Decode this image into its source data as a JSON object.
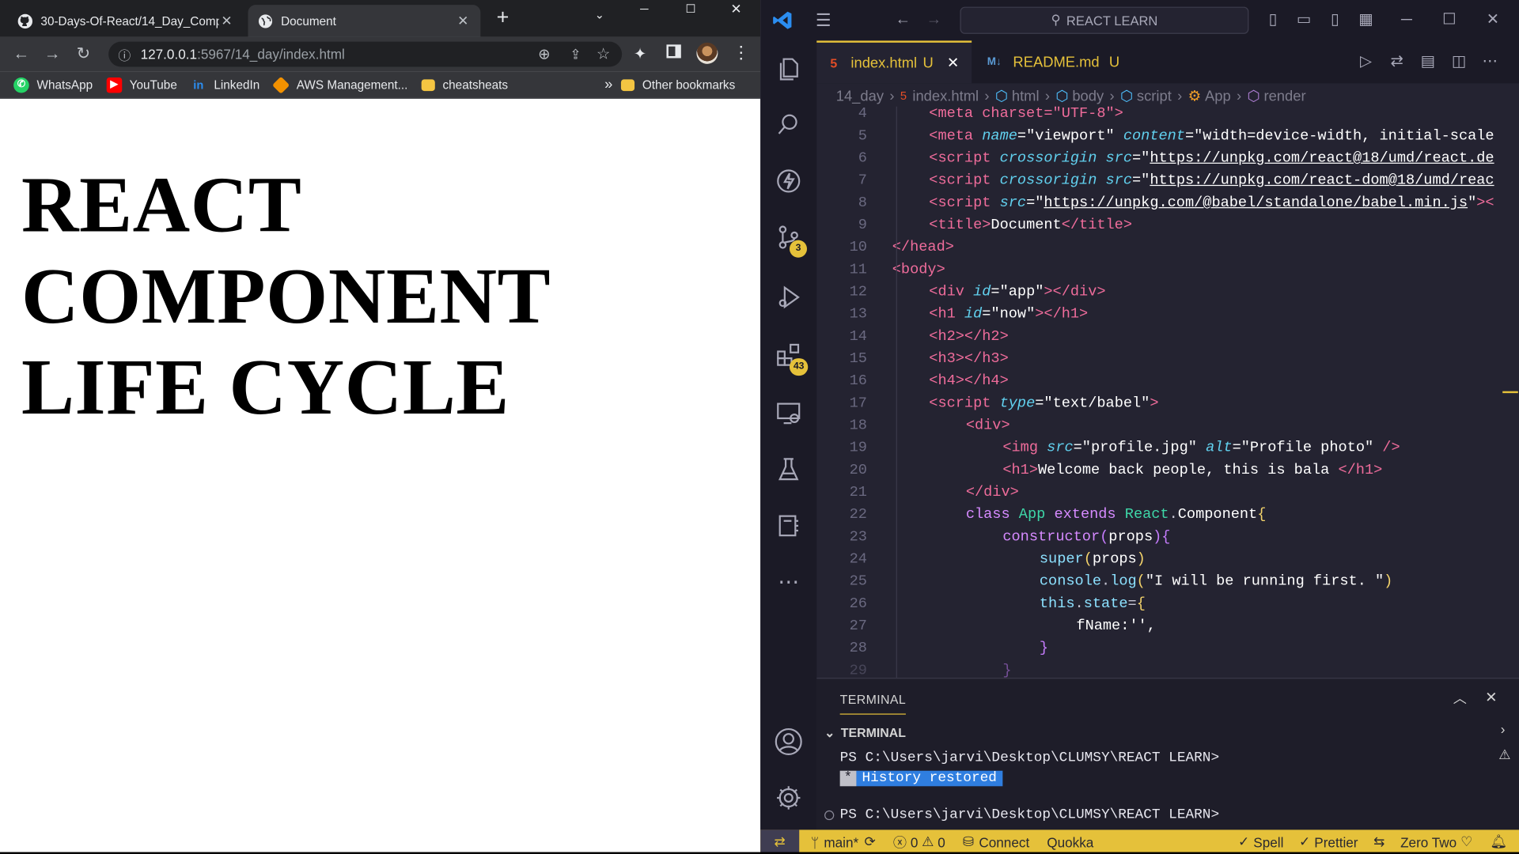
{
  "browser": {
    "tabs": [
      {
        "title": "30-Days-Of-React/14_Day_Comp",
        "icon": "github-icon"
      },
      {
        "title": "Document",
        "icon": "globe-icon"
      }
    ],
    "url_host": "127.0.0.1",
    "url_path": ":5967/14_day/index.html",
    "bookmarks": [
      {
        "label": "WhatsApp",
        "color": "#25d366"
      },
      {
        "label": "YouTube",
        "color": "#ff0000"
      },
      {
        "label": "LinkedIn",
        "color": "#0a66c2"
      },
      {
        "label": "AWS Management...",
        "color": "#f29100"
      },
      {
        "label": "cheatsheats",
        "color": "#f4c542"
      }
    ],
    "bookmarks_overflow": "»",
    "other_bookmarks": "Other bookmarks",
    "page_heading_lines": [
      "REACT",
      "COMPONENT",
      "LIFE CYCLE"
    ]
  },
  "vscode": {
    "search_label": "REACT LEARN",
    "accent": "#e5c13a",
    "activity_badges": {
      "source_control": "3",
      "extensions": "43"
    },
    "editor_tabs": [
      {
        "name": "index.html",
        "status": "U",
        "type": "html"
      },
      {
        "name": "README.md",
        "status": "U",
        "type": "md"
      }
    ],
    "breadcrumbs": [
      "14_day",
      "index.html",
      "html",
      "body",
      "script",
      "App",
      "render"
    ],
    "code_lines": [
      {
        "n": "4"
      },
      {
        "n": "5"
      },
      {
        "n": "6"
      },
      {
        "n": "7"
      },
      {
        "n": "8"
      },
      {
        "n": "9"
      },
      {
        "n": "10"
      },
      {
        "n": "11"
      },
      {
        "n": "12"
      },
      {
        "n": "13"
      },
      {
        "n": "14"
      },
      {
        "n": "15"
      },
      {
        "n": "16"
      },
      {
        "n": "17"
      },
      {
        "n": "18"
      },
      {
        "n": "19"
      },
      {
        "n": "20"
      },
      {
        "n": "21"
      },
      {
        "n": "22"
      },
      {
        "n": "23"
      },
      {
        "n": "24"
      },
      {
        "n": "25"
      },
      {
        "n": "26"
      },
      {
        "n": "27"
      },
      {
        "n": "28"
      }
    ],
    "code_text": {
      "l4": "<meta charset=\"UTF-8\">",
      "l5a": "<meta ",
      "l5b": "name",
      "l5c": "=\"viewport\" ",
      "l5d": "content",
      "l5e": "=\"width=device-width, initial-scale",
      "l6a": "<script ",
      "l6b": "crossorigin",
      "l6c": " src",
      "l6d": "=\"",
      "l6e": "https://unpkg.com/react@18/umd/react.de",
      "l7e": "https://unpkg.com/react-dom@18/umd/reac",
      "l8e": "https://unpkg.com/@babel/standalone/babel.min.js",
      "l9": "Document",
      "l17": "text/babel",
      "l19a": "profile.jpg",
      "l19b": "Profile photo",
      "l20": "Welcome back people, this is bala ",
      "l22a": "class",
      "l22b": "App",
      "l22c": "extends",
      "l22d": "React",
      "l22e": "Component",
      "l23a": "constructor",
      "l23b": "props",
      "l24a": "super",
      "l24b": "props",
      "l25a": "console",
      "l25b": "log",
      "l25c": "\"I will be running first. \"",
      "l26a": "this",
      "l26b": "state",
      "l27": "fName:'',"
    },
    "panel_tab": "TERMINAL",
    "terminal_section": "TERMINAL",
    "terminal_prompt": "PS C:\\Users\\jarvi\\Desktop\\CLUMSY\\REACT LEARN>",
    "history_star": "*",
    "history_msg": "History restored",
    "status": {
      "branch": "main*",
      "errors": "0",
      "warnings": "0",
      "connect": "Connect",
      "quokka": "Quokka",
      "spell": "Spell",
      "prettier": "Prettier",
      "theme": "Zero Two"
    }
  }
}
